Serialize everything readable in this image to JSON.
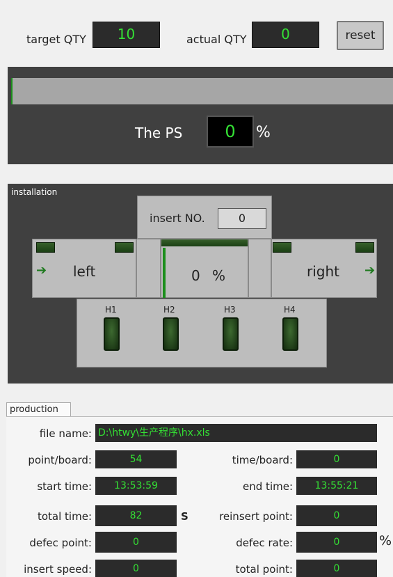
{
  "header": {
    "target_qty_label": "target QTY",
    "target_qty_value": "10",
    "actual_qty_label": "actual QTY",
    "actual_qty_value": "0",
    "reset_label": "reset"
  },
  "progress": {
    "fraction": 0.0,
    "ps_label": "The PS",
    "ps_value": "0",
    "ps_unit": "%"
  },
  "installation": {
    "title": "installation",
    "insert_no_label": "insert NO.",
    "insert_no_value": "0",
    "left_label": "left",
    "right_label": "right",
    "center_value": "0",
    "center_unit": "%",
    "heads": [
      "H1",
      "H2",
      "H3",
      "H4"
    ]
  },
  "production": {
    "tab_label": "production",
    "file_name_label": "file name:",
    "file_name_value": "D:\\htwy\\生产程序\\hx.xls",
    "point_board_label": "point/board:",
    "point_board_value": "54",
    "time_board_label": "time/board:",
    "time_board_value": "0",
    "start_time_label": "start time:",
    "start_time_value": "13:53:59",
    "end_time_label": "end time:",
    "end_time_value": "13:55:21",
    "total_time_label": "total time:",
    "total_time_value": "82",
    "total_time_unit": "S",
    "reinsert_point_label": "reinsert point:",
    "reinsert_point_value": "0",
    "defec_point_label": "defec point:",
    "defec_point_value": "0",
    "defec_rate_label": "defec rate:",
    "defec_rate_value": "0",
    "defec_rate_unit": "%",
    "insert_speed_label": "insert speed:",
    "insert_speed_value": "0",
    "total_point_label": "total point:",
    "total_point_value": "0"
  },
  "colors": {
    "display_text": "#34e034",
    "panel_dark": "#404040",
    "led_green": "#1e4a17"
  }
}
